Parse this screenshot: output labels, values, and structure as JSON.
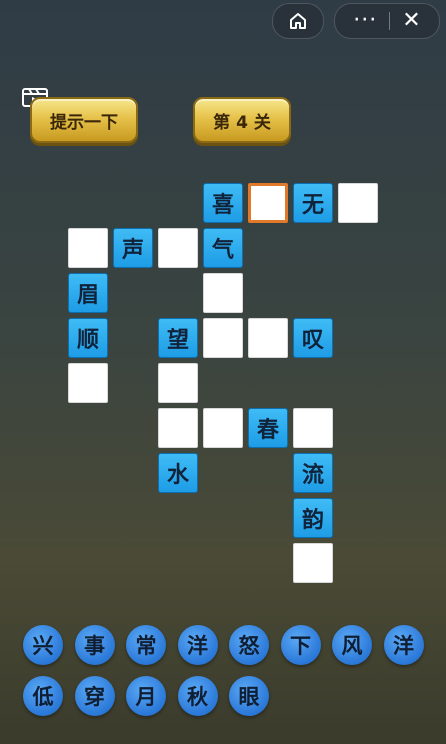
{
  "top_bar": {
    "home_icon": "home-icon",
    "more_icon": "more-dots-icon",
    "more_glyph": "···",
    "close_icon": "close-icon",
    "close_glyph": "✕"
  },
  "controls": {
    "video_icon": "video-icon",
    "hint_label": "提示一下",
    "level_label": "第 4 关"
  },
  "colors": {
    "filled_cell": "#1e9ce6",
    "empty_cell": "#ffffff",
    "selected_border": "#e07a2a",
    "bank_char": "#2a78d8",
    "gold_button": "#e6c24a"
  },
  "grid": {
    "cells": [
      {
        "row": 0,
        "col": 3,
        "char": "喜",
        "state": "filled"
      },
      {
        "row": 0,
        "col": 4,
        "char": "",
        "state": "empty",
        "selected": true
      },
      {
        "row": 0,
        "col": 5,
        "char": "无",
        "state": "filled"
      },
      {
        "row": 0,
        "col": 6,
        "char": "",
        "state": "empty"
      },
      {
        "row": 1,
        "col": 0,
        "char": "",
        "state": "empty"
      },
      {
        "row": 1,
        "col": 1,
        "char": "声",
        "state": "filled"
      },
      {
        "row": 1,
        "col": 2,
        "char": "",
        "state": "empty"
      },
      {
        "row": 1,
        "col": 3,
        "char": "气",
        "state": "filled"
      },
      {
        "row": 2,
        "col": 0,
        "char": "眉",
        "state": "filled"
      },
      {
        "row": 2,
        "col": 3,
        "char": "",
        "state": "empty"
      },
      {
        "row": 3,
        "col": 0,
        "char": "顺",
        "state": "filled"
      },
      {
        "row": 3,
        "col": 2,
        "char": "望",
        "state": "filled"
      },
      {
        "row": 3,
        "col": 3,
        "char": "",
        "state": "empty"
      },
      {
        "row": 3,
        "col": 4,
        "char": "",
        "state": "empty"
      },
      {
        "row": 3,
        "col": 5,
        "char": "叹",
        "state": "filled"
      },
      {
        "row": 4,
        "col": 0,
        "char": "",
        "state": "empty"
      },
      {
        "row": 4,
        "col": 2,
        "char": "",
        "state": "empty"
      },
      {
        "row": 5,
        "col": 2,
        "char": "",
        "state": "empty"
      },
      {
        "row": 5,
        "col": 3,
        "char": "",
        "state": "empty"
      },
      {
        "row": 5,
        "col": 4,
        "char": "春",
        "state": "filled"
      },
      {
        "row": 5,
        "col": 5,
        "char": "",
        "state": "empty"
      },
      {
        "row": 6,
        "col": 2,
        "char": "水",
        "state": "filled"
      },
      {
        "row": 6,
        "col": 5,
        "char": "流",
        "state": "filled"
      },
      {
        "row": 7,
        "col": 5,
        "char": "韵",
        "state": "filled"
      },
      {
        "row": 8,
        "col": 5,
        "char": "",
        "state": "empty"
      }
    ]
  },
  "character_bank": {
    "rows": [
      [
        "兴",
        "事",
        "常",
        "洋",
        "怒",
        "下",
        "风",
        "洋"
      ],
      [
        "低",
        "穿",
        "月",
        "秋",
        "眼"
      ]
    ]
  }
}
